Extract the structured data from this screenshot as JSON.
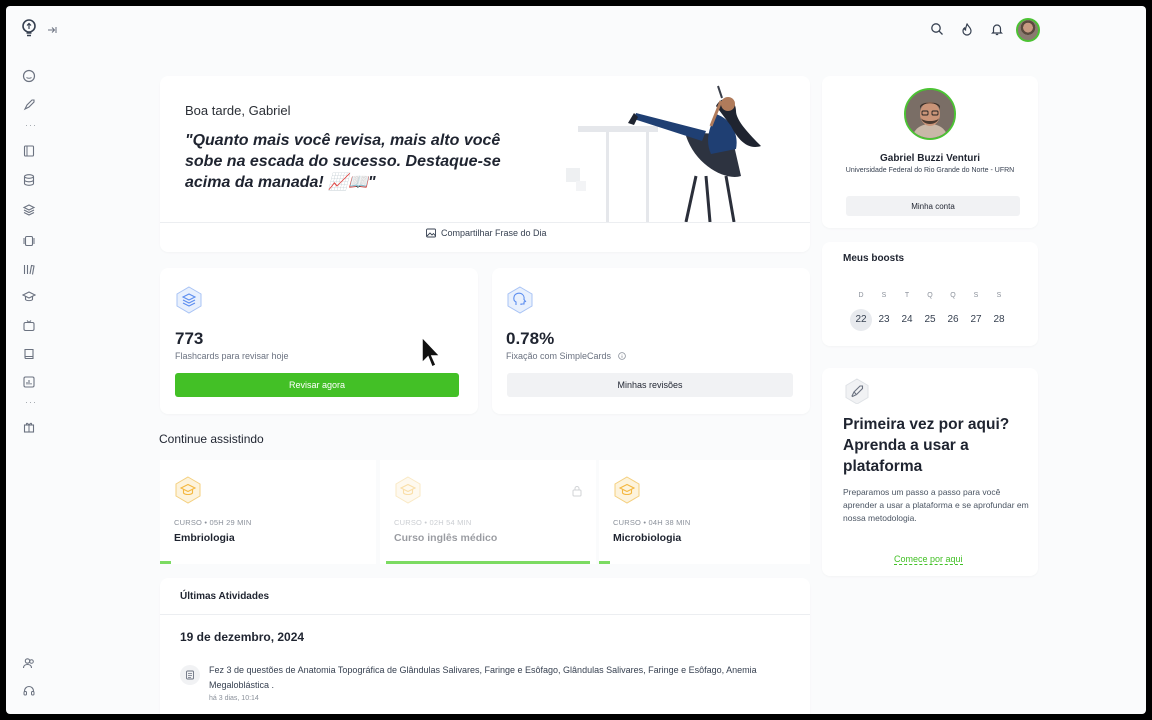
{
  "sidebar": {
    "logo_icon": "lightbulb-logo-icon",
    "collapse_icon": "collapse-arrow-icon",
    "items": [
      {
        "icon": "home-icon"
      },
      {
        "icon": "rocket-icon"
      },
      {
        "icon": "book-icon"
      },
      {
        "icon": "database-icon"
      },
      {
        "icon": "layers-icon"
      },
      {
        "icon": "cards-icon"
      },
      {
        "icon": "library-icon"
      },
      {
        "icon": "graduation-cap-icon"
      },
      {
        "icon": "tv-icon"
      },
      {
        "icon": "notebook-icon"
      },
      {
        "icon": "chart-icon"
      },
      {
        "icon": "gift-icon"
      }
    ],
    "bottom": [
      {
        "icon": "users-icon"
      },
      {
        "icon": "headset-icon"
      }
    ]
  },
  "topbar": {
    "icons": [
      "search-icon",
      "fire-icon",
      "bell-icon"
    ]
  },
  "hero": {
    "greeting": "Boa tarde, Gabriel",
    "quote": "\"Quanto mais você revisa, mais alto você sobe na escada do sucesso. Destaque-se acima da manada! 📈📖\"",
    "share_label": "Compartilhar Frase do Dia"
  },
  "stats": {
    "flashcards": {
      "value": "773",
      "label": "Flashcards para revisar hoje",
      "button": "Revisar agora"
    },
    "fixation": {
      "value": "0.78%",
      "label": "Fixação com SimpleCards",
      "button": "Minhas revisões"
    }
  },
  "continue": {
    "title": "Continue assistindo",
    "courses": [
      {
        "meta": "CURSO  •  05H 29 MIN",
        "name": "Embriologia",
        "progress": 0.05,
        "locked": false
      },
      {
        "meta": "CURSO  •  02H 54 MIN",
        "name": "Curso inglês médico",
        "progress": 1.0,
        "locked": true
      },
      {
        "meta": "CURSO  •  04H 38 MIN",
        "name": "Microbiologia",
        "progress": 0.05,
        "locked": false
      }
    ]
  },
  "activities": {
    "title": "Últimas Atividades",
    "date": "19 de dezembro, 2024",
    "items": [
      {
        "text": "Fez 3 de questões de Anatomia Topográfica de Glândulas Salivares, Faringe e Esôfago, Glândulas Salivares, Faringe e Esôfago, Anemia Megaloblástica .",
        "time": "há 3 dias, 10:14"
      }
    ]
  },
  "profile": {
    "name": "Gabriel Buzzi Venturi",
    "university": "Universidade Federal do Rio Grande do Norte - UFRN",
    "account_button": "Minha conta"
  },
  "boosts": {
    "title": "Meus boosts",
    "weekdays": [
      "D",
      "S",
      "T",
      "Q",
      "Q",
      "S",
      "S"
    ],
    "days": [
      "22",
      "23",
      "24",
      "25",
      "26",
      "27",
      "28"
    ],
    "today_index": 0
  },
  "onboarding": {
    "title": "Primeira vez por aqui? Aprenda a usar a plataforma",
    "text": "Preparamos um passo a passo para você aprender a usar a plataforma e se aprofundar em nossa metodologia.",
    "link": "Comece por aqui"
  },
  "colors": {
    "accent_green": "#43c026",
    "progress_green": "#7cdb62",
    "course_icon_orange": "#f4b740",
    "stat_icon_blue": "#5b8def"
  }
}
